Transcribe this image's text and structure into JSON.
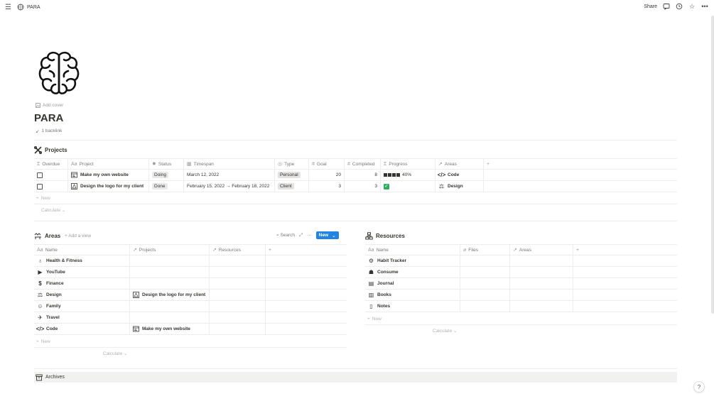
{
  "topbar": {
    "breadcrumb": "PARA",
    "share_label": "Share"
  },
  "page": {
    "add_cover": "Add cover",
    "title": "PARA",
    "backlinks": "1 backlink"
  },
  "projects": {
    "title": "Projects",
    "columns": [
      "Overdue",
      "Project",
      "Status",
      "Timespan",
      "Type",
      "Goal",
      "Completed",
      "Progress",
      "Areas"
    ],
    "rows": [
      {
        "project": "Make my own website",
        "status": "Doing",
        "timespan": "March 12, 2022",
        "type": "Personal",
        "goal": "20",
        "completed": "8",
        "progress": "40%",
        "area": "Code"
      },
      {
        "project": "Design the logo for my client",
        "status": "Done",
        "timespan": "February 15, 2022 → February 18, 2022",
        "type": "Client",
        "goal": "3",
        "completed": "3",
        "progress": "",
        "area": "Design"
      }
    ],
    "new_label": "New",
    "calculate_label": "Calculate"
  },
  "areas": {
    "title": "Areas",
    "add_view": "+ Add a view",
    "search_label": "Search",
    "new_button": "New",
    "columns": [
      "Name",
      "Projects",
      "Resources"
    ],
    "rows": [
      {
        "name": "Health & Fitness",
        "project": ""
      },
      {
        "name": "YouTube",
        "project": ""
      },
      {
        "name": "Finance",
        "project": ""
      },
      {
        "name": "Design",
        "project": "Design the logo for my client"
      },
      {
        "name": "Family",
        "project": ""
      },
      {
        "name": "Travel",
        "project": ""
      },
      {
        "name": "Code",
        "project": "Make my own website"
      }
    ],
    "new_label": "New",
    "calculate_label": "Calculate"
  },
  "resources": {
    "title": "Resources",
    "columns": [
      "Name",
      "Files",
      "Areas"
    ],
    "rows": [
      {
        "name": "Habit Tracker"
      },
      {
        "name": "Consume"
      },
      {
        "name": "Journal"
      },
      {
        "name": "Books"
      },
      {
        "name": "Notes"
      }
    ],
    "new_label": "New",
    "calculate_label": "Calculate"
  },
  "archives": {
    "title": "Archives"
  },
  "help": "?",
  "colors": {
    "accent": "#2383e2",
    "done_check": "#2fae62",
    "text": "#37352f",
    "muted": "#787774"
  }
}
